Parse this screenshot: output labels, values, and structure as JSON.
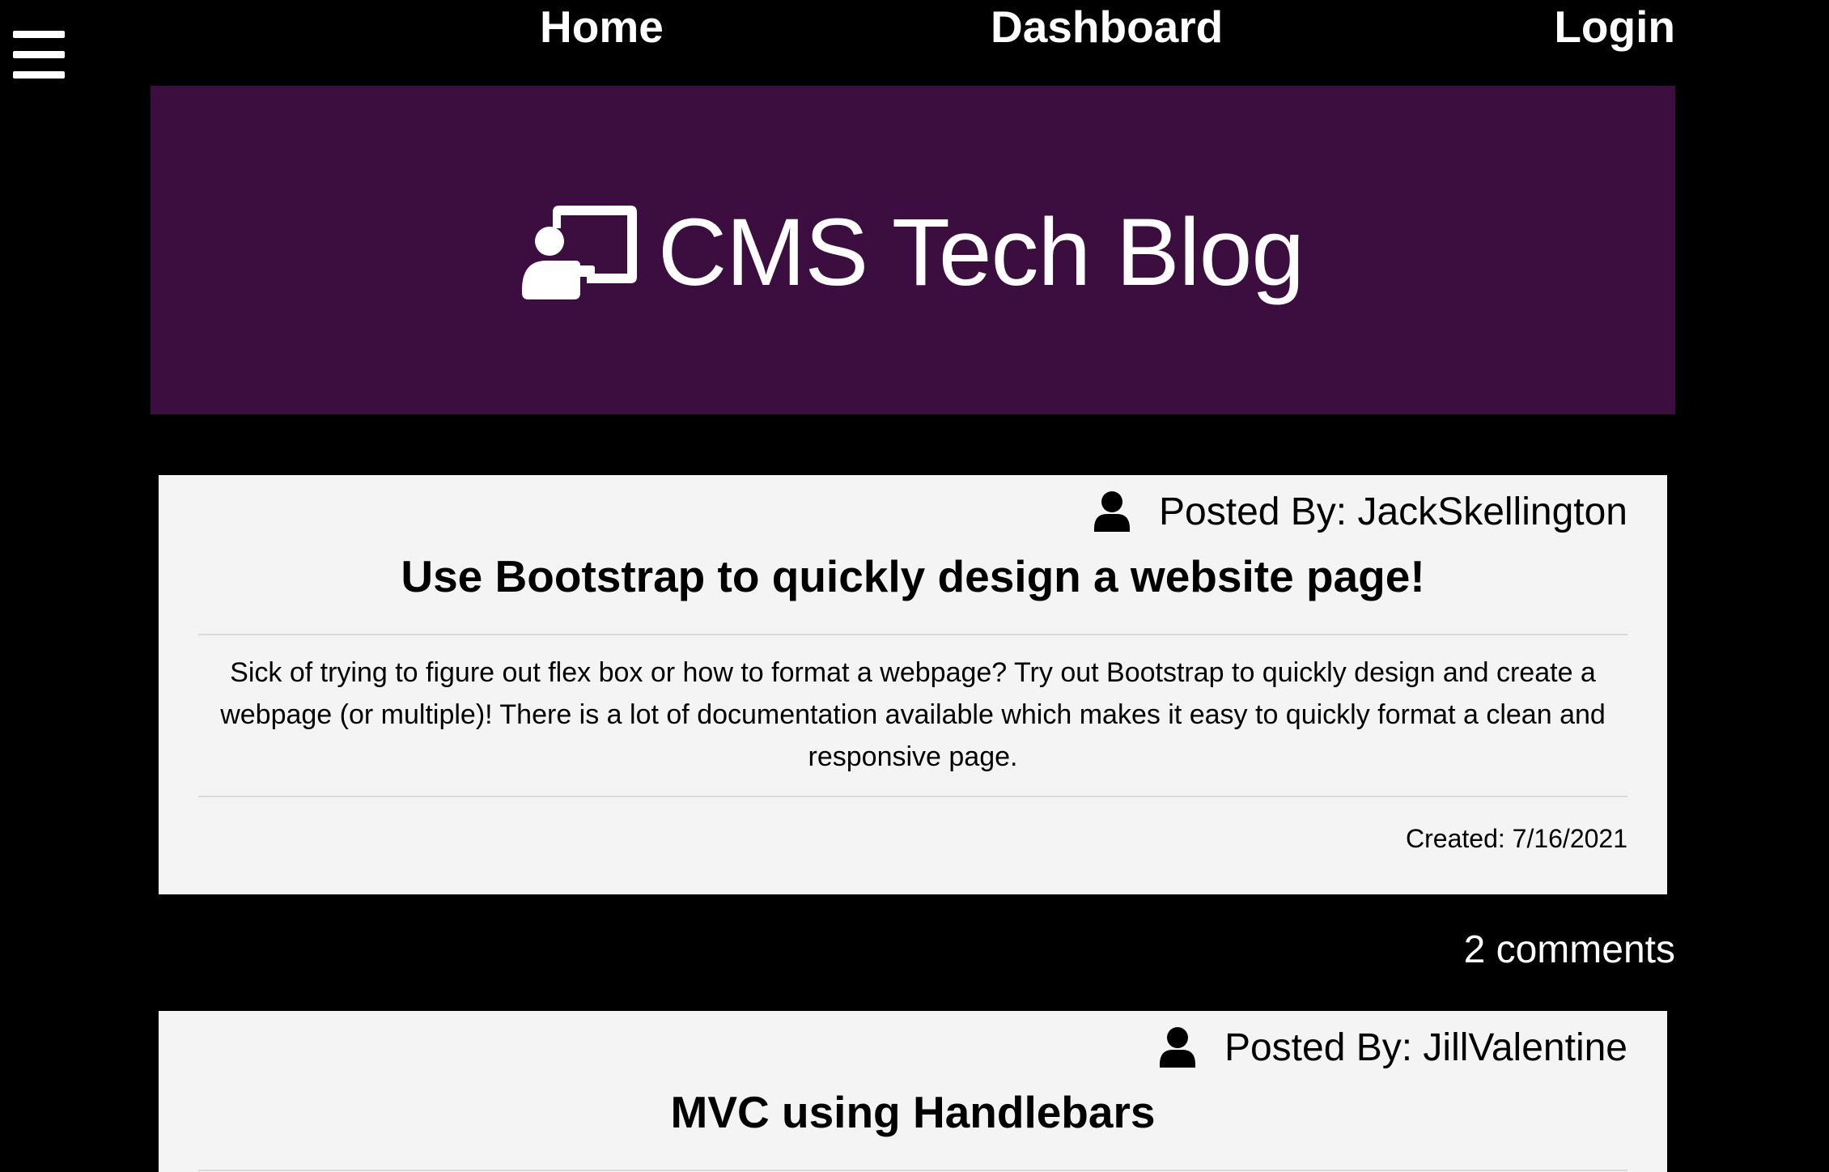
{
  "nav": {
    "menu_icon": "hamburger-menu-icon",
    "home": "Home",
    "dashboard": "Dashboard",
    "login": "Login"
  },
  "hero": {
    "icon": "chalkboard-teacher-icon",
    "title": "CMS Tech Blog",
    "background": "#3b0e3f"
  },
  "posts": [
    {
      "author_icon": "user-icon",
      "author": "Posted By: JackSkellington",
      "title": "Use Bootstrap to quickly design a website page!",
      "body": "Sick of trying to figure out flex box or how to format a webpage? Try out Bootstrap to quickly design and create a webpage (or multiple)! There is a lot of documentation available which makes it easy to quickly format a clean and responsive page.",
      "created": "Created: 7/16/2021",
      "comments": "2 comments"
    },
    {
      "author_icon": "user-icon",
      "author": "Posted By: JillValentine",
      "title": "MVC using Handlebars"
    }
  ]
}
